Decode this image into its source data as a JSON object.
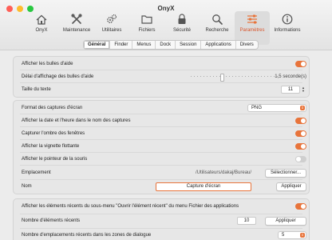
{
  "window": {
    "title": "OnyX"
  },
  "toolbar": {
    "items": [
      {
        "label": "OnyX",
        "icon": "house-icon"
      },
      {
        "label": "Maintenance",
        "icon": "wrench-icon"
      },
      {
        "label": "Utilitaires",
        "icon": "gears-icon"
      },
      {
        "label": "Fichiers",
        "icon": "folder-icon"
      },
      {
        "label": "Sécurité",
        "icon": "lock-icon"
      },
      {
        "label": "Recherche",
        "icon": "search-icon"
      },
      {
        "label": "Paramètres",
        "icon": "sliders-icon"
      },
      {
        "label": "Informations",
        "icon": "info-icon"
      }
    ],
    "active_index": 6
  },
  "tabs": [
    "Général",
    "Finder",
    "Menus",
    "Dock",
    "Session",
    "Applications",
    "Divers"
  ],
  "active_tab": "Général",
  "group1": {
    "show_help_bubbles": {
      "label": "Afficher les bulles d'aide",
      "on": true
    },
    "help_delay": {
      "label": "Délai d'affichage des bulles d'aide",
      "value": "1,5",
      "unit": "seconde(s)",
      "level": 0.35
    },
    "text_size": {
      "label": "Taille du texte",
      "value": "11"
    }
  },
  "group2": {
    "format": {
      "label": "Format des captures d'écran",
      "value": "PNG"
    },
    "show_date": {
      "label": "Afficher la date et l'heure dans le nom des captures",
      "on": true
    },
    "shadow": {
      "label": "Capturer l'ombre des fenêtres",
      "on": true
    },
    "thumbnail": {
      "label": "Afficher la vignette flottante",
      "on": true
    },
    "pointer": {
      "label": "Afficher le pointeur de la souris",
      "on": false
    },
    "location": {
      "label": "Emplacement",
      "path": "/Utilisateurs/dakaj/Bureau/",
      "button": "Sélectionner..."
    },
    "name": {
      "label": "Nom",
      "value": "Capture d'écran",
      "button": "Appliquer"
    }
  },
  "group3": {
    "recent_items": {
      "label": "Afficher les éléments récents du sous-menu \"Ouvrir l'élément récent\" du menu Fichier des applications",
      "on": true
    },
    "recent_count": {
      "label": "Nombre d'éléments récents",
      "value": "10",
      "button": "Appliquer"
    },
    "recent_locations": {
      "label": "Nombre d'emplacements récents dans les zones de dialogue",
      "value": "5"
    }
  },
  "colors": {
    "accent": "#e8743b",
    "toggle_off": "#cfcfcf",
    "background": "#ececec"
  }
}
